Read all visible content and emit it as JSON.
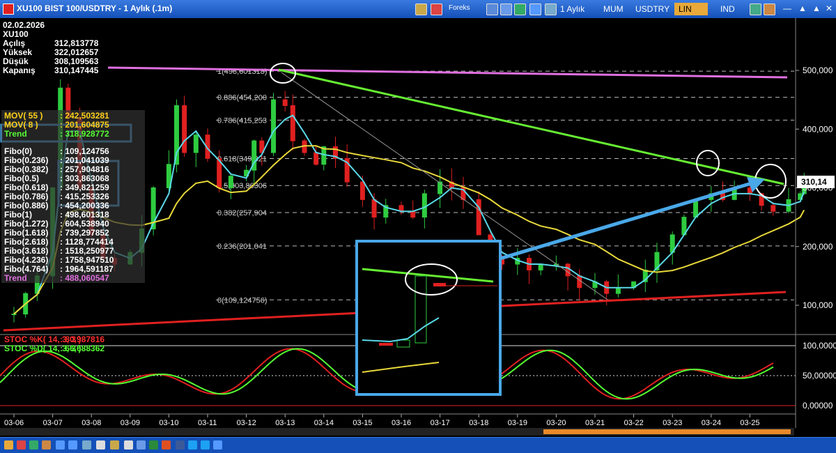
{
  "window": {
    "title": "XU100 BIST 100/USDTRY - 1 Aylık (.1m)",
    "toolbar": {
      "timeframe": "1 Aylık",
      "style_tab": "MUM",
      "currency_tab": "USDTRY",
      "scale_tab": "LIN",
      "ind_tab": "IND",
      "brand": "Foreks"
    }
  },
  "info": {
    "date": "02.02.2026",
    "symbol": "XU100",
    "rows": [
      {
        "label": "Açılış",
        "value": "312,813778"
      },
      {
        "label": "Yüksek",
        "value": "322,012657"
      },
      {
        "label": "Düşük",
        "value": "308,109563"
      },
      {
        "label": "Kapanış",
        "value": "310,147445"
      }
    ]
  },
  "legend": {
    "mov": [
      {
        "label": "MOV( 55 )",
        "value": ": 242,503281",
        "color": "#ffd11a"
      },
      {
        "label": "MOV( 8 )",
        "value": ": 201,604875",
        "color": "#ffd11a"
      },
      {
        "label": "Trend",
        "value": ": 318,928772",
        "color": "#55ff33"
      }
    ],
    "fibo": [
      {
        "label": "Fibo(0)",
        "value": ": 109,124756"
      },
      {
        "label": "Fibo(0.236)",
        "value": ": 201,041039"
      },
      {
        "label": "Fibo(0.382)",
        "value": ": 257,904816"
      },
      {
        "label": "Fibo(0.5)",
        "value": ": 303,863068"
      },
      {
        "label": "Fibo(0.618)",
        "value": ": 349,821259"
      },
      {
        "label": "Fibo(0.786)",
        "value": ": 415,253326"
      },
      {
        "label": "Fibo(0.886)",
        "value": ": 454,200336"
      },
      {
        "label": "Fibo(1)",
        "value": ": 498,601318"
      },
      {
        "label": "Fibo(1.272)",
        "value": ": 604,538940"
      },
      {
        "label": "Fibo(1.618)",
        "value": ": 739,297852"
      },
      {
        "label": "Fibo(2.618)",
        "value": ": 1128,774414"
      },
      {
        "label": "Fibo(3.618)",
        "value": ": 1518,250977"
      },
      {
        "label": "Fibo(4.236)",
        "value": ": 1758,947510"
      },
      {
        "label": "Fibo(4.764)",
        "value": ": 1964,591187"
      }
    ],
    "trend2": {
      "label": "Trend",
      "value": ": 488,060547",
      "color": "#e070e0"
    },
    "stoc_k": {
      "label": "STOC %K( 14, 3, 3 )",
      "value": ": 80,987816",
      "color": "#ff3030"
    },
    "stoc_d": {
      "label": "STOC %D( 14, 3, 3 )",
      "value": ": 66,688362",
      "color": "#55ff33"
    }
  },
  "chart_data": [
    {
      "type": "candlestick",
      "title": "XU100 BIST 100/USDTRY",
      "y_axis_ticks": [
        {
          "value": 100,
          "label": "100,000"
        },
        {
          "value": 200,
          "label": "200,000"
        },
        {
          "value": 300,
          "label": "300,000"
        },
        {
          "value": 400,
          "label": "400,000"
        },
        {
          "value": 500,
          "label": "500,000"
        }
      ],
      "last_price_label": "310,14",
      "x_tick_labels": [
        "03-06",
        "03-07",
        "03-08",
        "03-09",
        "03-10",
        "03-11",
        "03-12",
        "03-13",
        "03-14",
        "03-15",
        "03-16",
        "03-17",
        "03-18",
        "03-19",
        "03-20",
        "03-21",
        "03-22",
        "03-23",
        "03-24",
        "03-25"
      ],
      "fib_levels": [
        {
          "ratio": "1",
          "value": 498.601318,
          "label": "1(498,601318)"
        },
        {
          "ratio": "0.886",
          "value": 454.2,
          "label": "0.886(454,200"
        },
        {
          "ratio": "0.786",
          "value": 415.253,
          "label": "0.786(415,253"
        },
        {
          "ratio": "0.618",
          "value": 349.821,
          "label": "0.618(349,821"
        },
        {
          "ratio": "0.5",
          "value": 303.86306,
          "label": "0.5(303,86306"
        },
        {
          "ratio": "0.382",
          "value": 257.904,
          "label": "0.382(257,904"
        },
        {
          "ratio": "0.236",
          "value": 201.041,
          "label": "0.236(201,041"
        },
        {
          "ratio": "0",
          "value": 109.124756,
          "label": "0(109,124756)"
        }
      ],
      "close_series": [
        [
          0,
          85
        ],
        [
          0.3,
          120
        ],
        [
          0.6,
          150
        ],
        [
          1,
          300
        ],
        [
          1.2,
          470
        ],
        [
          1.4,
          420
        ],
        [
          1.7,
          300
        ],
        [
          2,
          220
        ],
        [
          2.3,
          180
        ],
        [
          2.6,
          170
        ],
        [
          3,
          190
        ],
        [
          3.3,
          230
        ],
        [
          3.6,
          300
        ],
        [
          4,
          340
        ],
        [
          4.2,
          440
        ],
        [
          4.4,
          360
        ],
        [
          4.7,
          390
        ],
        [
          5,
          350
        ],
        [
          5.3,
          300
        ],
        [
          5.6,
          320
        ],
        [
          6,
          330
        ],
        [
          6.2,
          380
        ],
        [
          6.4,
          360
        ],
        [
          6.7,
          450
        ],
        [
          7,
          440
        ],
        [
          7.2,
          380
        ],
        [
          7.5,
          360
        ],
        [
          7.8,
          340
        ],
        [
          8,
          370
        ],
        [
          8.3,
          350
        ],
        [
          8.6,
          310
        ],
        [
          9,
          280
        ],
        [
          9.3,
          250
        ],
        [
          9.6,
          270
        ],
        [
          10,
          260
        ],
        [
          10.3,
          250
        ],
        [
          10.6,
          290
        ],
        [
          11,
          310
        ],
        [
          11.3,
          300
        ],
        [
          11.6,
          280
        ],
        [
          12,
          220
        ],
        [
          12.3,
          180
        ],
        [
          12.6,
          170
        ],
        [
          13,
          180
        ],
        [
          13.3,
          160
        ],
        [
          13.6,
          170
        ],
        [
          14,
          170
        ],
        [
          14.3,
          150
        ],
        [
          14.6,
          130
        ],
        [
          15,
          140
        ],
        [
          15.3,
          120
        ],
        [
          15.6,
          130
        ],
        [
          16,
          140
        ],
        [
          16.3,
          160
        ],
        [
          16.6,
          190
        ],
        [
          17,
          220
        ],
        [
          17.3,
          250
        ],
        [
          17.6,
          280
        ],
        [
          18,
          290
        ],
        [
          18.3,
          280
        ],
        [
          18.6,
          300
        ],
        [
          19,
          290
        ],
        [
          19.3,
          270
        ],
        [
          19.6,
          260
        ],
        [
          20,
          280
        ],
        [
          20.3,
          290
        ],
        [
          20.4,
          310
        ]
      ],
      "ma_fast_label": "MOV( 8 )",
      "ma_slow_label": "MOV( 55 )"
    },
    {
      "type": "line",
      "title": "STOC",
      "y_axis_ticks": [
        {
          "value": 0,
          "label": "0,00000"
        },
        {
          "value": 50,
          "label": "50,00000"
        },
        {
          "value": 100,
          "label": "100,0000"
        }
      ]
    }
  ]
}
